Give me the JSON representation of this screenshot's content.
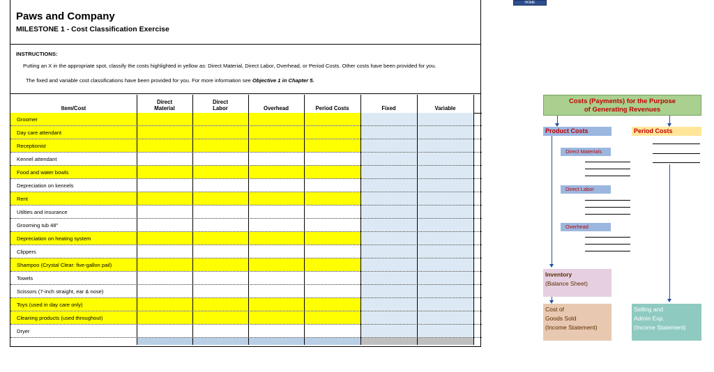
{
  "header": {
    "company": "Paws and Company",
    "milestone": "MILESTONE 1 - Cost Classification Exercise"
  },
  "instructions": {
    "heading": "INSTRUCTIONS:",
    "paragraph1": "Putting an X in the appropriate spot, classify the costs highlighted in yellow as: Direct Material, Direct Labor, Overhead, or Period Costs. Other costs have been provided for you.",
    "paragraph2_prefix": "The fixed and variable cost classifications have been provided for you. For more information see ",
    "paragraph2_ref": "Objective 1 in Chapter 5."
  },
  "table": {
    "columns": {
      "item": "Item/Cost",
      "direct_material": "Direct\nMaterial",
      "direct_labor": "Direct\nLabor",
      "overhead": "Overhead",
      "period": "Period Costs",
      "fixed": "Fixed",
      "variable": "Variable"
    },
    "rows": [
      {
        "label": "Groomer",
        "highlight": true
      },
      {
        "label": "Day care attendant",
        "highlight": true
      },
      {
        "label": "Receptionist",
        "highlight": true
      },
      {
        "label": "Kennel attendant",
        "highlight": false
      },
      {
        "label": "Food and water bowls",
        "highlight": true
      },
      {
        "label": "Depreciation on kennels",
        "highlight": false
      },
      {
        "label": "Rent",
        "highlight": true
      },
      {
        "label": "Utilties and insurance",
        "highlight": false
      },
      {
        "label": "Grooming tub 48\"",
        "highlight": false
      },
      {
        "label": "Depreciation on heating system",
        "highlight": true
      },
      {
        "label": "Clippers",
        "highlight": false
      },
      {
        "label": "Shampoo (Crystal Clear: five-gallon pail)",
        "highlight": true
      },
      {
        "label": "Towels",
        "highlight": false
      },
      {
        "label": "Scissors (7-inch straight, ear & nose)",
        "highlight": false
      },
      {
        "label": "Toys (used in day care only)",
        "highlight": true
      },
      {
        "label": "Cleaning products (used throughout)",
        "highlight": true
      },
      {
        "label": "Dryer",
        "highlight": false
      }
    ]
  },
  "home_button": {
    "label": "HOME"
  },
  "diagram": {
    "title_line1": "Costs (Payments) for the Purpose",
    "title_line2": "of Generating Revenues",
    "product_costs": "Product Costs",
    "period_costs": "Period Costs",
    "direct_materials": "Direct Materials",
    "direct_labor": "Direct Labor",
    "overhead": "Overhead",
    "inventory_line1": "Inventory",
    "inventory_line2": "(Balance Sheet)",
    "cogs_line1": "Cost of",
    "cogs_line2": "Goods Sold",
    "cogs_line3": "(Income Statement)",
    "sga_line1": "Selling and",
    "sga_line2": "Admin  Exp.",
    "sga_line3": "(Income Statement)"
  },
  "colors": {
    "highlight_yellow": "#ffff00",
    "fixed_variable_blue": "#dce9f5",
    "title_green": "#a9d08e",
    "label_red": "#c00000"
  }
}
